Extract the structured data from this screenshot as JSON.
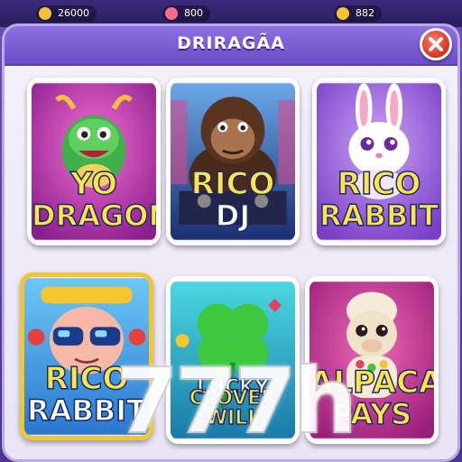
{
  "hud": {
    "coins": "26000",
    "gems": "800",
    "extra": "882"
  },
  "dialog": {
    "title": "DRIRAGÃA"
  },
  "games": [
    {
      "line1": "YO",
      "line2": "DRAGON",
      "bg": "#c63db8"
    },
    {
      "line1": "RICO",
      "line2": "DJ",
      "bg": "#3b4ea8"
    },
    {
      "line1": "RICO",
      "line2": "RABBIT",
      "bg": "#8a5ad8"
    },
    {
      "line1": "RICO",
      "line2": "RABBIT",
      "bg": "#3aa0e8"
    },
    {
      "line1": "LUCKY",
      "line2": "CLOVER WILL",
      "bg": "#2bb5c8"
    },
    {
      "line1": "ALPACA",
      "line2": "PAYS",
      "bg": "#d84a9a"
    }
  ],
  "watermark": "777h"
}
